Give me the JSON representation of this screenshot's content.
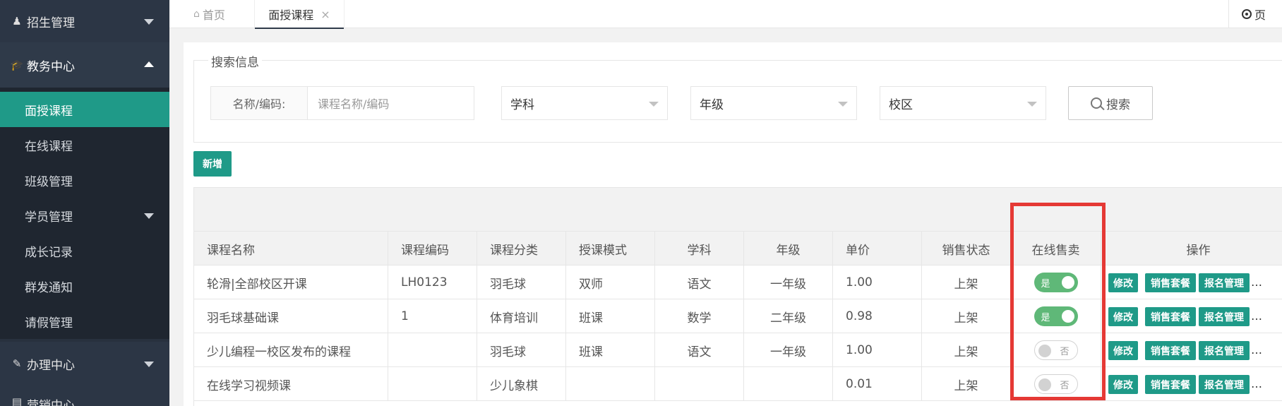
{
  "sidebar": {
    "groups": [
      {
        "label": "招生管理",
        "icon": "user-icon"
      },
      {
        "label": "教务中心",
        "icon": "graduation-cap-icon"
      },
      {
        "label": "办理中心",
        "icon": "edit-icon"
      },
      {
        "label": "营销中心",
        "icon": "list-icon"
      }
    ],
    "items": [
      {
        "label": "面授课程"
      },
      {
        "label": "在线课程"
      },
      {
        "label": "班级管理"
      },
      {
        "label": "学员管理"
      },
      {
        "label": "成长记录"
      },
      {
        "label": "群发通知"
      },
      {
        "label": "请假管理"
      }
    ]
  },
  "tabs": {
    "home": "首页",
    "active": "面授课程",
    "right": "页"
  },
  "search": {
    "legend": "搜索信息",
    "name_label": "名称/编码:",
    "name_placeholder": "课程名称/编码",
    "subject": "学科",
    "grade": "年级",
    "campus": "校区",
    "button": "搜索"
  },
  "add_button": "新增",
  "table": {
    "headers": [
      "课程名称",
      "课程编码",
      "课程分类",
      "授课模式",
      "学科",
      "年级",
      "单价",
      "销售状态",
      "在线售卖",
      "操作"
    ],
    "rows": [
      {
        "name": "轮滑|全部校区开课",
        "code": "LH0123",
        "category": "羽毛球",
        "mode": "双师",
        "subject": "语文",
        "grade": "一年级",
        "price": "1.00",
        "status": "上架",
        "online": "是",
        "online_on": true
      },
      {
        "name": "羽毛球基础课",
        "code": "1",
        "category": "体育培训",
        "mode": "班课",
        "subject": "数学",
        "grade": "二年级",
        "price": "0.98",
        "status": "上架",
        "online": "是",
        "online_on": true
      },
      {
        "name": "少儿编程一校区发布的课程",
        "code": "",
        "category": "羽毛球",
        "mode": "班课",
        "subject": "语文",
        "grade": "一年级",
        "price": "1.00",
        "status": "上架",
        "online": "否",
        "online_on": false
      },
      {
        "name": "在线学习视频课",
        "code": "",
        "category": "少儿象棋",
        "mode": "",
        "subject": "",
        "grade": "",
        "price": "0.01",
        "status": "上架",
        "online": "否",
        "online_on": false
      }
    ],
    "ops": {
      "edit": "修改",
      "package": "销售套餐",
      "enroll": "报名管理",
      "more": "…"
    }
  },
  "colors": {
    "accent": "#1f9a88",
    "sidebar": "#28313e",
    "switch_on": "#5fb878",
    "highlight": "#e53935"
  }
}
